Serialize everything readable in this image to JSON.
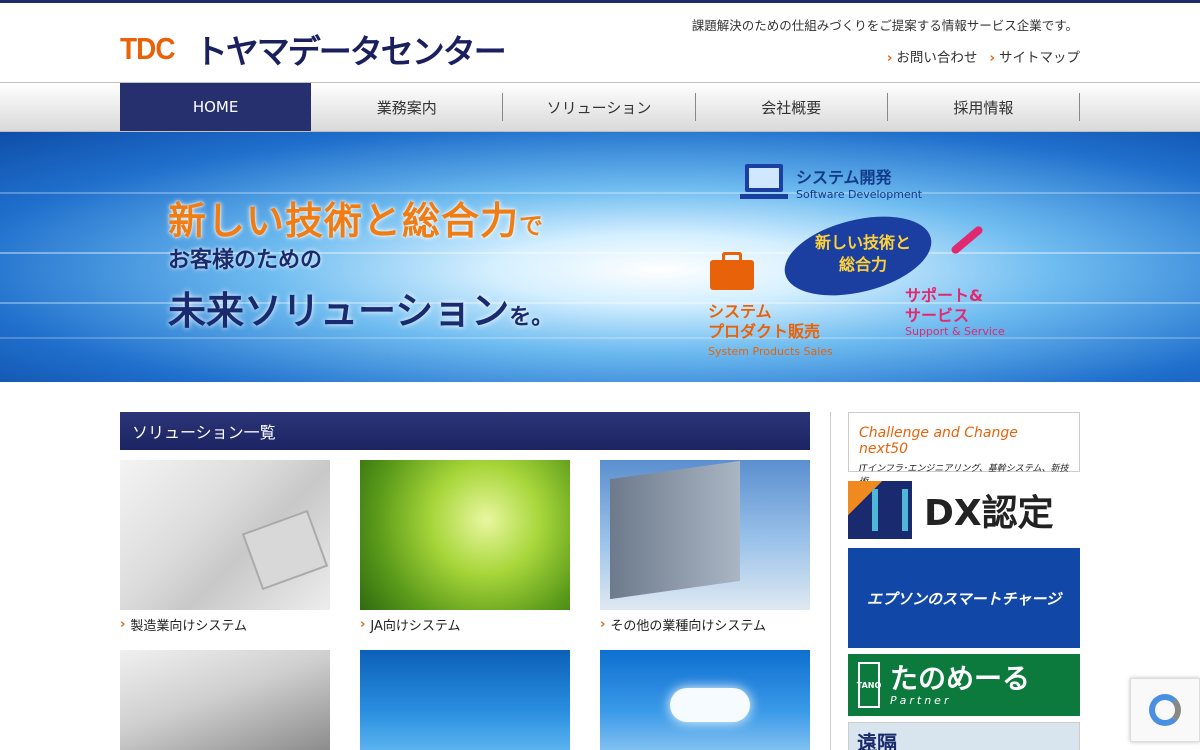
{
  "header": {
    "logo_mark": "TDC",
    "logo_name": "トヤマデータセンター",
    "tagline": "課題解決のための仕組みづくりをご提案する情報サービス企業です。",
    "links": [
      {
        "label": "お問い合わせ",
        "icon": "chevron-right-icon"
      },
      {
        "label": "サイトマップ",
        "icon": "chevron-right-icon"
      }
    ]
  },
  "nav": {
    "items": [
      {
        "label": "HOME",
        "active": true
      },
      {
        "label": "業務案内",
        "active": false
      },
      {
        "label": "ソリューション",
        "active": false
      },
      {
        "label": "会社概要",
        "active": false
      },
      {
        "label": "採用情報",
        "active": false
      }
    ]
  },
  "hero": {
    "line1_a": "新しい技術と総合力",
    "line1_b": "で",
    "line2": "お客様のための",
    "line3_a": "未来ソリューション",
    "line3_b": "を。",
    "center_label_1": "新しい技術と",
    "center_label_2": "総合力",
    "system_dev_jp": "システム開発",
    "system_dev_en": "Software Development",
    "products_jp_1": "システム",
    "products_jp_2": "プロダクト販売",
    "products_en": "System Products Sales",
    "support_jp_1": "サポート&",
    "support_jp_2": "サービス",
    "support_en": "Support & Service",
    "colors": {
      "orange": "#f07c14",
      "navy": "#1a2a6e",
      "pink": "#e2286e"
    }
  },
  "main": {
    "section_title": "ソリューション一覧",
    "cards": [
      {
        "label": "製造業向けシステム",
        "icon": "chevron-right-icon"
      },
      {
        "label": "JA向けシステム",
        "icon": "chevron-right-icon"
      },
      {
        "label": "その他の業種向けシステム",
        "icon": "chevron-right-icon"
      }
    ]
  },
  "sidebar": {
    "challenge_title": "Challenge and Change next50",
    "challenge_sub": "ITインフラ･エンジニアリング、基幹システム、新技術",
    "dx_label": "DX認定",
    "epson_label": "エプソンのスマートチャージ",
    "tano_mark": "TANO",
    "tano_label": "たのめーる",
    "tano_sub": "Partner",
    "remote_label": "遠隔"
  },
  "colors": {
    "brand_orange": "#e8620a",
    "brand_navy": "#1f2a6b"
  }
}
